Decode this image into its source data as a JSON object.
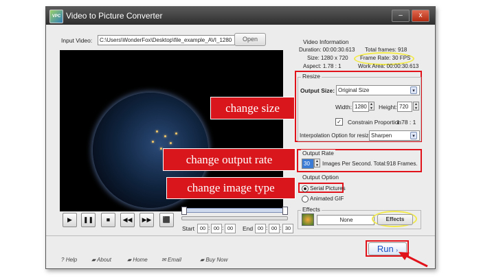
{
  "window": {
    "title": "Video to Picture Converter",
    "minimize_glyph": "–",
    "close_glyph": "x",
    "icon_text": "VPC"
  },
  "input": {
    "label": "Input Video:",
    "value": "C:\\Users\\WonderFox\\Desktop\\file_example_AVI_1280",
    "open_label": "Open"
  },
  "video_info": {
    "title": "Video Information",
    "duration": "Duration: 00:00:30.613",
    "total_frames": "Total frames: 918",
    "size": "Size: 1280 x 720",
    "frame_rate": "Frame Rate: 30 FPS",
    "aspect": "Aspect: 1.78 : 1",
    "work_area": "Work Area: 00:00:30.613"
  },
  "resize": {
    "title": "Resize",
    "output_size_label": "Output Size:",
    "output_size_value": "Original Size",
    "width_label": "Width:",
    "width_value": "1280",
    "height_label": "Height:",
    "height_value": "720",
    "constrain_label": "Constrain Proportion",
    "constrain_ratio": "1.78 : 1",
    "constrain_checked": true,
    "interp_label": "Interpolation Option for resize:",
    "interp_value": "Sharpen"
  },
  "output_rate": {
    "title": "Output Rate",
    "value": "30",
    "text": "Images Per Second. Total:918 Frames."
  },
  "output_option": {
    "title": "Output Option",
    "serial_label": "Serial Pictures",
    "gif_label": "Animated GIF",
    "selected": "Serial Pictures"
  },
  "effects": {
    "title": "Effects",
    "value": "None",
    "button_label": "Effects"
  },
  "player": {
    "buttons": [
      "▶",
      "❚❚",
      "■",
      "◀◀",
      "▶▶",
      "⬛"
    ],
    "start_label": "Start",
    "start_time": [
      "00",
      "00",
      "00"
    ],
    "end_label": "End",
    "end_time": [
      "00",
      "00",
      "30"
    ]
  },
  "footer": {
    "help": "Help",
    "about": "About",
    "home": "Home",
    "email": "Email",
    "buy": "Buy Now",
    "help_glyph": "?"
  },
  "run": {
    "label": "Run"
  },
  "callouts": {
    "size": "change size",
    "rate": "change output rate",
    "type": "change image type"
  },
  "colors": {
    "annotation_red": "#e1121a",
    "highlight_yellow": "#f2ea4a",
    "run_blue": "#1a4fc4"
  }
}
